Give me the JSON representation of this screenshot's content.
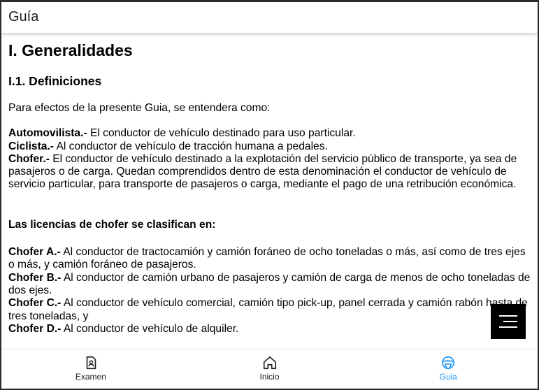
{
  "appbar": {
    "title": "Guía"
  },
  "content": {
    "heading": "I. Generalidades",
    "subheading": "I.1. Definiciones",
    "intro": "Para efectos de la presente Guia, se entendera como:",
    "definitions": [
      {
        "term": "Automovilista.-",
        "text": " El conductor de vehículo destinado para uso particular."
      },
      {
        "term": "Ciclista.-",
        "text": " Al conductor de vehículo de tracción humana a pedales."
      },
      {
        "term": "Chofer.-",
        "text": " El conductor de vehículo destinado a la explotación del servicio público de transporte, ya sea de pasajeros o de carga. Quedan comprendidos dentro de esta denominación el conductor de vehículo de servicio particular, para transporte de pasajeros o carga, mediante el pago de una retribución económica."
      }
    ],
    "licenses_heading": "Las licencias de chofer se clasifican en:",
    "licenses": [
      {
        "term": "Chofer A.-",
        "text": " Al conductor de tractocamión y camión foráneo de ocho toneladas o más, así como de tres ejes o más, y camión foráneo de pasajeros."
      },
      {
        "term": "Chofer B.-",
        "text": " Al conductor de camión urbano de pasajeros y camión de carga de menos de ocho toneladas de dos ejes."
      },
      {
        "term": "Chofer C.-",
        "text": " Al conductor de vehículo comercial, camión tipo pick-up, panel cerrada y camión rabón hasta de tres toneladas, y"
      },
      {
        "term": "Chofer D.-",
        "text": " Al conductor de vehículo de alquiler."
      }
    ]
  },
  "fab": {
    "icon": "menu-icon"
  },
  "bottom_nav": {
    "items": [
      {
        "label": "Examen",
        "icon": "exam-badge-icon",
        "active": false
      },
      {
        "label": "Inicio",
        "icon": "home-icon",
        "active": false
      },
      {
        "label": "Guia",
        "icon": "steering-wheel-icon",
        "active": true
      }
    ],
    "active_color": "#2196f3",
    "inactive_color": "#222222"
  }
}
